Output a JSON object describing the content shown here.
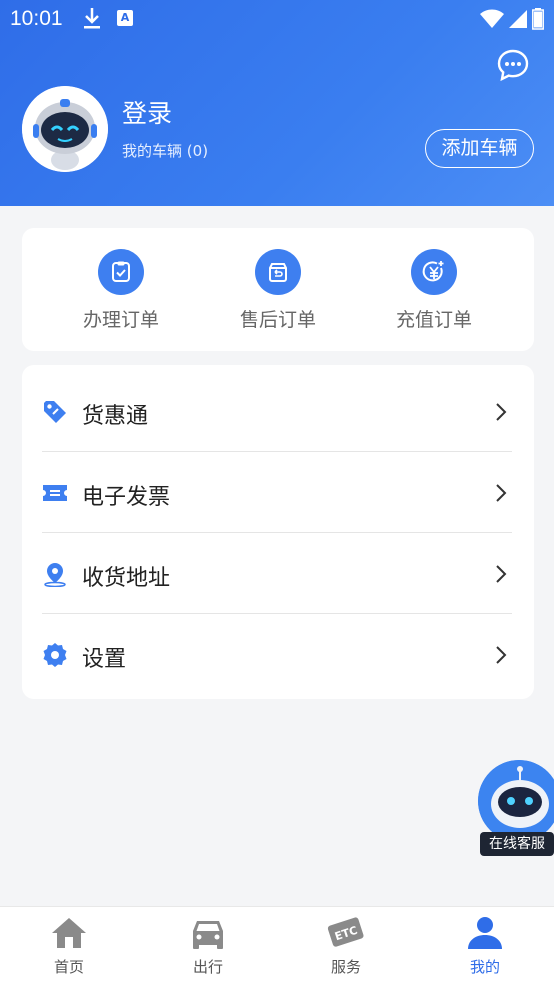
{
  "status_bar": {
    "time": "10:01"
  },
  "header": {
    "login_label": "登录",
    "my_cars_label": "我的车辆",
    "my_cars_count": "(0)",
    "add_car_button": "添加车辆"
  },
  "orders": [
    {
      "label": "办理订单",
      "icon": "clipboard-check-icon"
    },
    {
      "label": "售后订单",
      "icon": "return-box-icon"
    },
    {
      "label": "充值订单",
      "icon": "yuan-coin-icon"
    }
  ],
  "menu": [
    {
      "label": "货惠通",
      "icon": "tag-icon"
    },
    {
      "label": "电子发票",
      "icon": "ticket-icon"
    },
    {
      "label": "收货地址",
      "icon": "location-pin-icon"
    },
    {
      "label": "设置",
      "icon": "gear-icon"
    }
  ],
  "floating_service": {
    "label": "在线客服"
  },
  "tabbar": [
    {
      "label": "首页",
      "icon": "home-icon",
      "active": false
    },
    {
      "label": "出行",
      "icon": "car-icon",
      "active": false
    },
    {
      "label": "服务",
      "icon": "etc-card-icon",
      "active": false
    },
    {
      "label": "我的",
      "icon": "user-icon",
      "active": true
    }
  ],
  "colors": {
    "primary": "#2f6de8",
    "icon_blue": "#3e7ff0",
    "tab_inactive": "#8a8a8a"
  }
}
